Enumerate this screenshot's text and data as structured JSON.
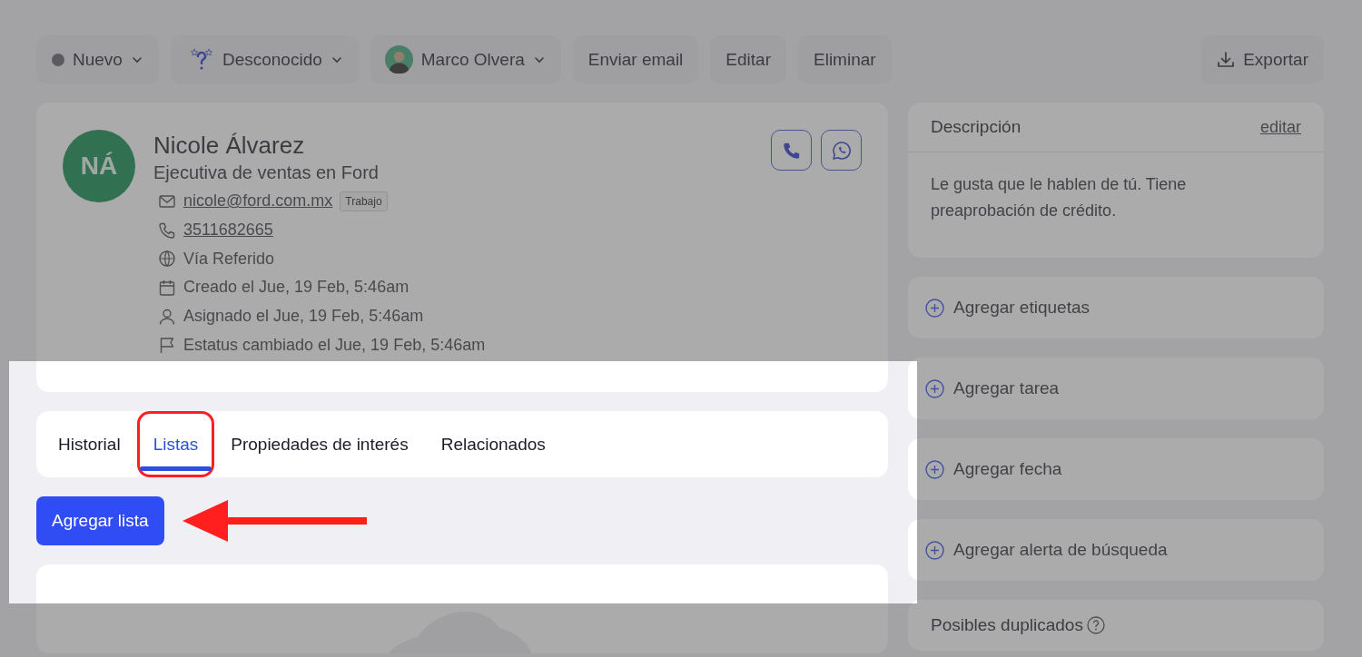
{
  "toolbar": {
    "status": {
      "label": "Nuevo",
      "color": "#5f5f66"
    },
    "category": {
      "label": "Desconocido"
    },
    "owner": {
      "label": "Marco Olvera"
    },
    "actions": [
      "Enviar email",
      "Editar",
      "Eliminar"
    ],
    "export": "Exportar"
  },
  "contact": {
    "initials": "NÁ",
    "name": "Nicole Álvarez",
    "title": "Ejecutiva de ventas en Ford",
    "details": [
      {
        "kind": "email",
        "text": "nicole@ford.com.mx",
        "tag": "Trabajo"
      },
      {
        "kind": "phone",
        "text": "3511682665"
      },
      {
        "kind": "source",
        "text": "Vía Referido"
      },
      {
        "kind": "created",
        "text": "Creado el Jue, 19 Feb, 5:46am"
      },
      {
        "kind": "assigned",
        "text": "Asignado el Jue, 19 Feb, 5:46am"
      },
      {
        "kind": "status",
        "text": "Estatus cambiado el Jue, 19 Feb, 5:46am"
      }
    ]
  },
  "tabs": [
    {
      "label": "Historial",
      "selected": false,
      "highlighted": false
    },
    {
      "label": "Listas",
      "selected": true,
      "highlighted": true
    },
    {
      "label": "Propiedades de interés",
      "selected": false,
      "highlighted": false
    },
    {
      "label": "Relacionados",
      "selected": false,
      "highlighted": false
    }
  ],
  "add_list_button": {
    "label": "Agregar lista",
    "pointed_at": true
  },
  "description": {
    "title": "Descripción",
    "edit_link": "editar",
    "text": "Le gusta que le hablen de tú. Tiene preaprobación de crédito."
  },
  "side_actions": [
    "Agregar etiquetas",
    "Agregar tarea",
    "Agregar fecha",
    "Agregar alerta de búsqueda"
  ],
  "duplicates": {
    "title": "Posibles duplicados"
  }
}
